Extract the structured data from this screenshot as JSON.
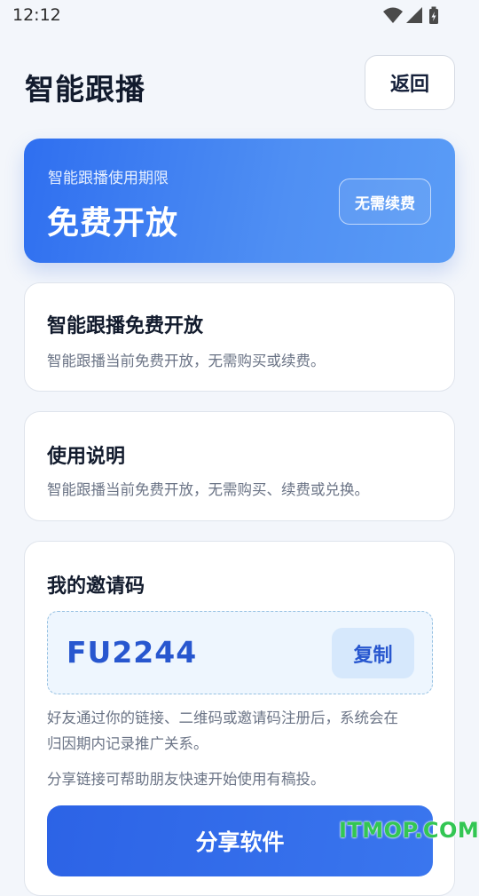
{
  "status_bar": {
    "time": "12:12"
  },
  "header": {
    "title": "智能跟播",
    "back_label": "返回"
  },
  "hero": {
    "subtitle": "智能跟播使用期限",
    "title": "免费开放",
    "badge": "无需续费"
  },
  "notice_card": {
    "title": "智能跟播免费开放",
    "text": "智能跟播当前免费开放，无需购买或续费。"
  },
  "usage_card": {
    "title": "使用说明",
    "text": "智能跟播当前免费开放，无需购买、续费或兑换。"
  },
  "invite_card": {
    "title": "我的邀请码",
    "code": "FU2244",
    "copy_label": "复制",
    "desc_line1": "好友通过你的链接、二维码或邀请码注册后，系统会在",
    "desc_line2": "归因期内记录推广关系。",
    "share_hint": "分享链接可帮助朋友快速开始使用有稿投。",
    "share_label": "分享软件"
  },
  "watermark": "ITMOP.COM",
  "colors": {
    "accent": "#2f6ff0",
    "code": "#2857cf",
    "watermark": "#33c653"
  }
}
